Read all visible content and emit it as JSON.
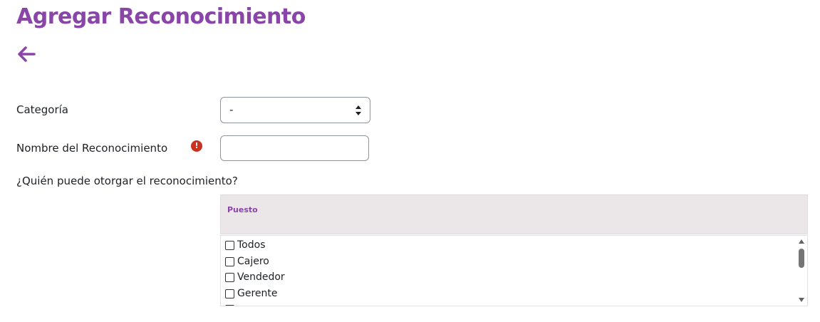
{
  "page": {
    "title": "Agregar Reconocimiento",
    "back_icon": "arrow-left-icon",
    "accent_color": "#8a45a8",
    "error_color": "#ca3120"
  },
  "form": {
    "category": {
      "label": "Categoría",
      "selected_value": "-"
    },
    "name": {
      "label": "Nombre del Reconocimiento",
      "value": "",
      "required_icon": "exclamation-circle-icon",
      "required_symbol": "!"
    },
    "who_can_grant": {
      "label": "¿Quién puede otorgar el reconocimiento?"
    }
  },
  "positions_table": {
    "header": "Puesto",
    "items": [
      {
        "label": "Todos",
        "checked": false
      },
      {
        "label": "Cajero",
        "checked": false
      },
      {
        "label": "Vendedor",
        "checked": false
      },
      {
        "label": "Gerente",
        "checked": false
      }
    ]
  }
}
